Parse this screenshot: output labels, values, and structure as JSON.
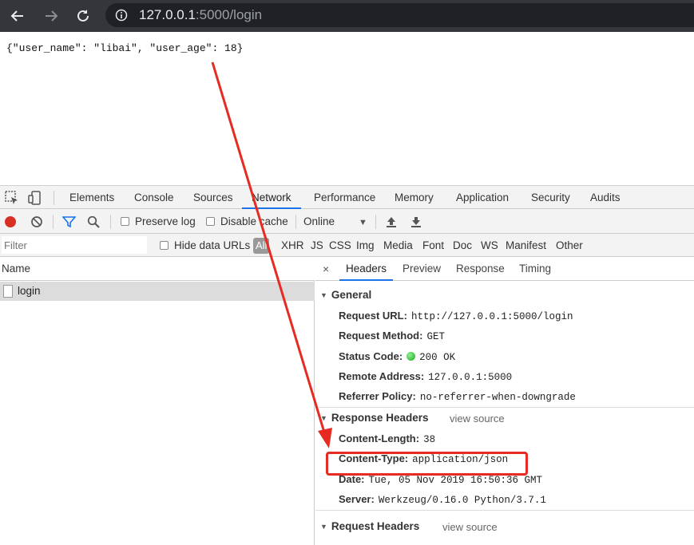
{
  "browser": {
    "url_host": "127.0.0.1",
    "url_path": ":5000/login"
  },
  "page": {
    "body_text": "{\"user_name\": \"libai\", \"user_age\": 18}"
  },
  "devtools": {
    "tabs": [
      "Elements",
      "Console",
      "Sources",
      "Network",
      "Performance",
      "Memory",
      "Application",
      "Security",
      "Audits"
    ],
    "active_tab": "Network",
    "toolbar": {
      "preserve_log": "Preserve log",
      "disable_cache": "Disable cache",
      "throttle": "Online"
    },
    "filter": {
      "placeholder": "Filter",
      "hide_data_urls": "Hide data URLs",
      "types": [
        "All",
        "XHR",
        "JS",
        "CSS",
        "Img",
        "Media",
        "Font",
        "Doc",
        "WS",
        "Manifest",
        "Other"
      ]
    },
    "requests": {
      "header": "Name",
      "items": [
        "login"
      ]
    },
    "detail": {
      "close": "×",
      "tabs": [
        "Headers",
        "Preview",
        "Response",
        "Timing"
      ],
      "general": {
        "title": "General",
        "request_url_key": "Request URL:",
        "request_url": "http://127.0.0.1:5000/login",
        "method_key": "Request Method:",
        "method": "GET",
        "status_key": "Status Code:",
        "status": "200 OK",
        "remote_key": "Remote Address:",
        "remote": "127.0.0.1:5000",
        "referrer_key": "Referrer Policy:",
        "referrer": "no-referrer-when-downgrade"
      },
      "response_headers": {
        "title": "Response Headers",
        "view_source": "view source",
        "length_key": "Content-Length:",
        "length": "38",
        "type_key": "Content-Type:",
        "type": "application/json",
        "date_key": "Date:",
        "date": "Tue, 05 Nov 2019 16:50:36 GMT",
        "server_key": "Server:",
        "server": "Werkzeug/0.16.0 Python/3.7.1"
      },
      "request_headers": {
        "title": "Request Headers",
        "view_source": "view source"
      }
    }
  },
  "colors": {
    "annotation": "#e52b22",
    "accent": "#1a73e8",
    "record": "#d93025",
    "status_ok": "#1fa81f"
  }
}
